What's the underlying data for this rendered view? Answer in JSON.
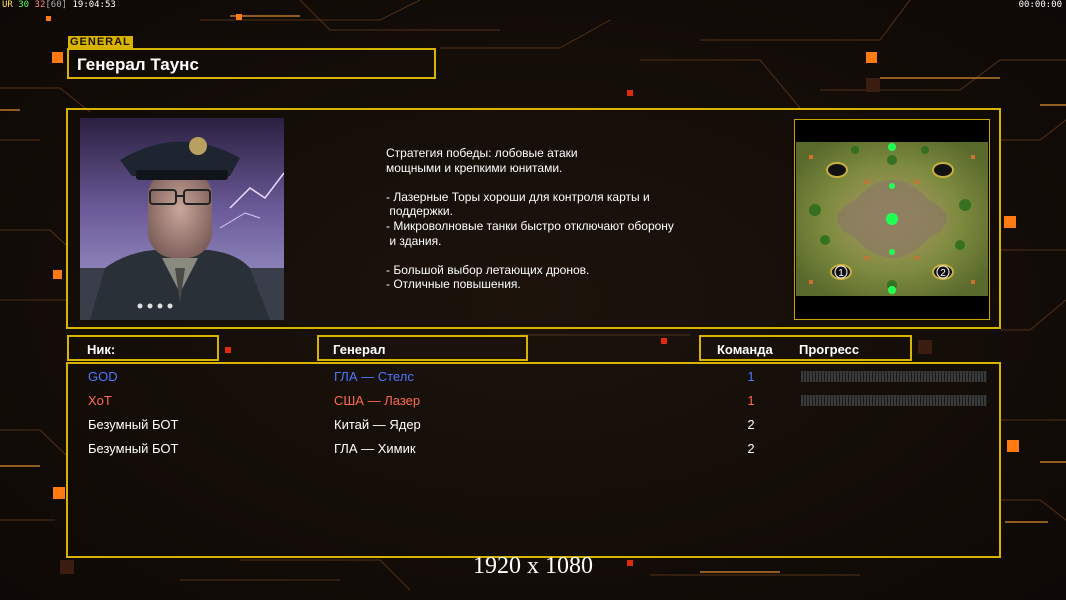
{
  "hud": {
    "ur_label": "UR",
    "fps_a": "30",
    "fps_b": "32",
    "fps_c": "[60]",
    "time": "19:04:53",
    "timer": "00:00:00"
  },
  "general": {
    "tag": "GENERAL",
    "name": "Генерал Таунс",
    "description": "Стратегия победы: лобовые атаки\nмощными и крепкими юнитами.\n\n- Лазерные Торы хороши для контроля карты и\n поддержки.\n- Микроволновые танки быстро отключают оборону\n и здания.\n\n- Большой выбор летающих дронов.\n- Отличные повышения."
  },
  "minimap": {
    "start_positions": [
      "1",
      "2"
    ]
  },
  "table": {
    "headers": {
      "nick": "Ник:",
      "general": "Генерал",
      "team": "Команда",
      "progress": "Прогресс"
    },
    "rows": [
      {
        "nick": "GOD",
        "general": "ГЛА — Стелс",
        "team": "1",
        "color": "#4a78ff",
        "show_progress": true
      },
      {
        "nick": "XoT",
        "general": "США — Лазер",
        "team": "1",
        "color": "#ff6a4a",
        "show_progress": true
      },
      {
        "nick": "Безумный БОТ",
        "general": "Китай — Ядер",
        "team": "2",
        "color": "#ffffff",
        "show_progress": false
      },
      {
        "nick": "Безумный БОТ",
        "general": "ГЛА — Химик",
        "team": "2",
        "color": "#ffffff",
        "show_progress": false
      }
    ]
  },
  "resolution": "1920 x 1080",
  "colors": {
    "frame": "#d8b400",
    "accent_orange": "#ff7a12",
    "background": "#120c08"
  }
}
